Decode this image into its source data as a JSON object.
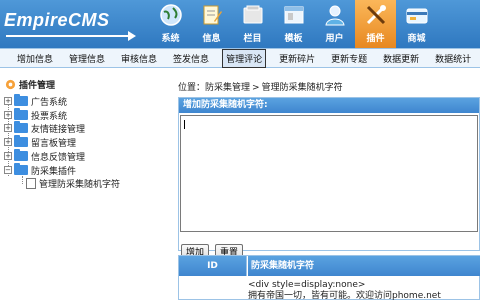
{
  "header": {
    "logo": "EmpireCMS",
    "nav": [
      {
        "label": "系统",
        "icon": "globe-icon"
      },
      {
        "label": "信息",
        "icon": "document-edit-icon"
      },
      {
        "label": "栏目",
        "icon": "folder-icon"
      },
      {
        "label": "模板",
        "icon": "template-window-icon"
      },
      {
        "label": "用户",
        "icon": "user-icon"
      },
      {
        "label": "插件",
        "icon": "tools-icon",
        "active": true
      },
      {
        "label": "商城",
        "icon": "shop-card-icon"
      }
    ]
  },
  "submenu": [
    "增加信息",
    "管理信息",
    "审核信息",
    "签发信息",
    "管理评论",
    "更新碎片",
    "更新专题",
    "数据更新",
    "数据统计"
  ],
  "submenu_active": "管理评论",
  "tree": {
    "title": "插件管理",
    "items": [
      "广告系统",
      "投票系统",
      "友情链接管理",
      "留言板管理",
      "信息反馈管理",
      "防采集插件"
    ],
    "child": "管理防采集随机字符"
  },
  "main": {
    "position_label": "位置：",
    "breadcrumb": [
      "防采集管理",
      "管理防采集随机字符"
    ],
    "form_title": "增加防采集随机字符:",
    "textarea_value": "",
    "add_button": "增加",
    "reset_button": "重置",
    "table": {
      "headers": [
        "ID",
        "防采集随机字符"
      ],
      "rows": [
        [
          "",
          "<div style=display:none>\n拥有帝国一切，皆有可能。欢迎访问phome.net"
        ]
      ]
    }
  },
  "colors": {
    "header_blue": "#3f86cf",
    "active_orange": "#f39a32",
    "submenu_bg": "#eef5fc"
  }
}
